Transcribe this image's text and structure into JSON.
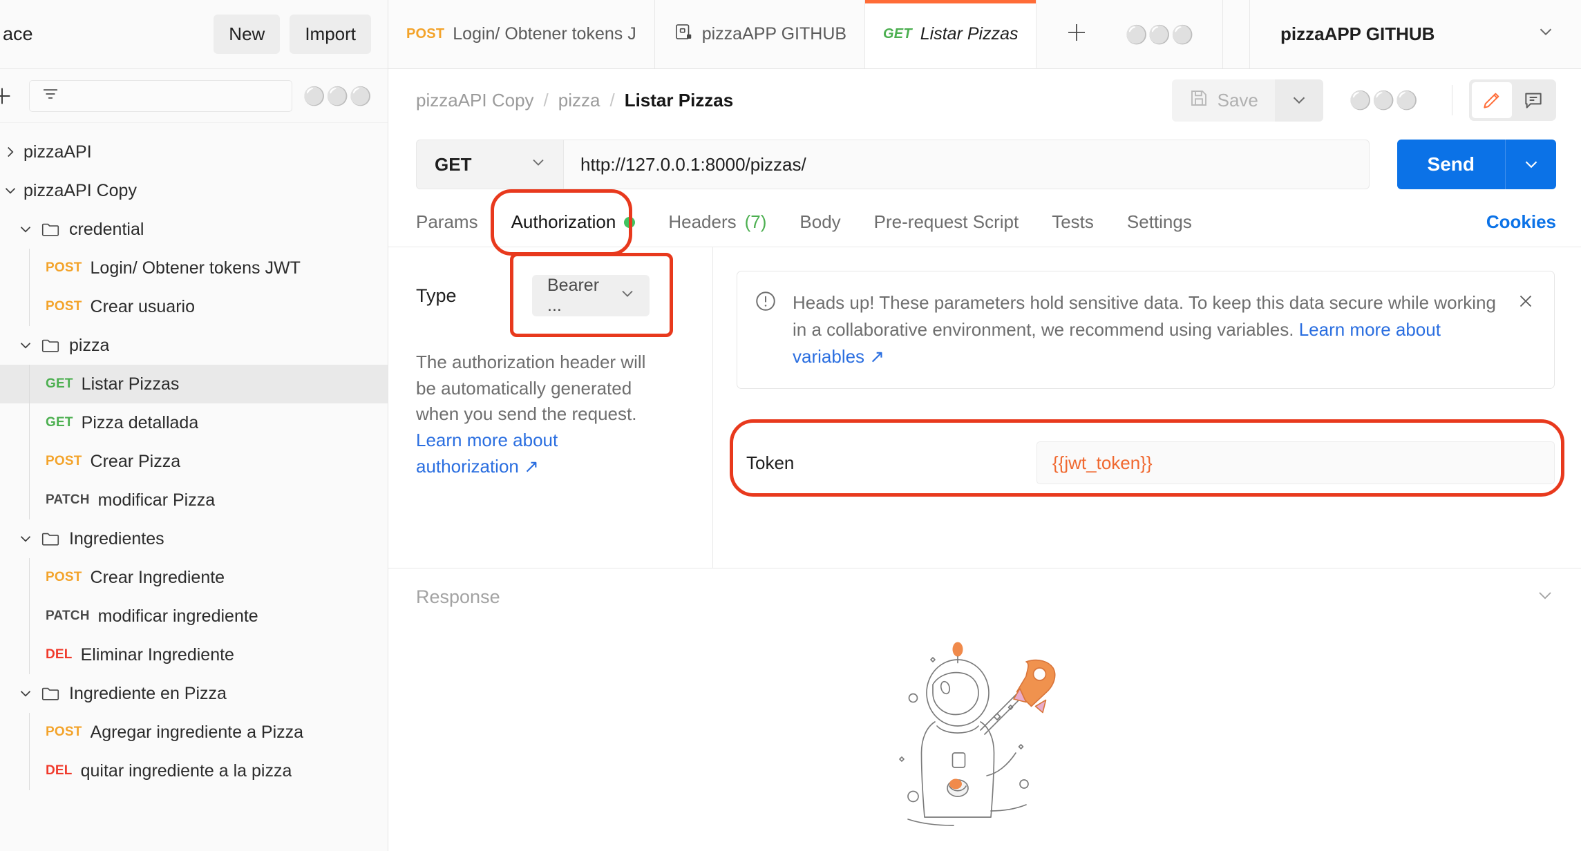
{
  "sidebar": {
    "workspace_title": "ace",
    "new_label": "New",
    "import_label": "Import",
    "filter_placeholder": "",
    "tree": [
      {
        "type": "collection",
        "label": "pizzaAPI",
        "expanded": false,
        "indent": 0
      },
      {
        "type": "collection",
        "label": "pizzaAPI Copy",
        "expanded": true,
        "indent": 0
      },
      {
        "type": "folder",
        "label": "credential",
        "expanded": true,
        "indent": 1
      },
      {
        "type": "request",
        "method": "POST",
        "label": "Login/ Obtener tokens JWT",
        "indent": 2
      },
      {
        "type": "request",
        "method": "POST",
        "label": "Crear usuario",
        "indent": 2
      },
      {
        "type": "folder",
        "label": "pizza",
        "expanded": true,
        "indent": 1
      },
      {
        "type": "request",
        "method": "GET",
        "label": "Listar Pizzas",
        "indent": 2,
        "selected": true
      },
      {
        "type": "request",
        "method": "GET",
        "label": "Pizza detallada",
        "indent": 2
      },
      {
        "type": "request",
        "method": "POST",
        "label": "Crear Pizza",
        "indent": 2
      },
      {
        "type": "request",
        "method": "PATCH",
        "label": "modificar Pizza",
        "indent": 2
      },
      {
        "type": "folder",
        "label": "Ingredientes",
        "expanded": true,
        "indent": 1
      },
      {
        "type": "request",
        "method": "POST",
        "label": "Crear Ingrediente",
        "indent": 2
      },
      {
        "type": "request",
        "method": "PATCH",
        "label": "modificar ingrediente",
        "indent": 2
      },
      {
        "type": "request",
        "method": "DEL",
        "label": "Eliminar Ingrediente",
        "indent": 2
      },
      {
        "type": "folder",
        "label": "Ingrediente en Pizza",
        "expanded": true,
        "indent": 1
      },
      {
        "type": "request",
        "method": "POST",
        "label": "Agregar ingrediente a Pizza",
        "indent": 2
      },
      {
        "type": "request",
        "method": "DEL",
        "label": "quitar ingrediente a la pizza",
        "indent": 2
      }
    ]
  },
  "tabstrip": {
    "tabs": [
      {
        "method": "POST",
        "name": "Login/ Obtener tokens J",
        "active": false,
        "icon": ""
      },
      {
        "method": "",
        "name": "pizzaAPP GITHUB",
        "active": false,
        "icon": "environment-icon"
      },
      {
        "method": "GET",
        "name": "Listar Pizzas",
        "active": true,
        "icon": ""
      }
    ],
    "new_tab_icon": "plus-icon",
    "more_tabs_icon": "ellipsis-icon",
    "environment_name": "pizzaAPP GITHUB",
    "environment_caret_icon": "chevron-down-icon"
  },
  "breadcrumb": {
    "items": [
      "pizzaAPI Copy",
      "pizza",
      "Listar Pizzas"
    ],
    "separator": "/",
    "save_label": "Save",
    "save_icon": "floppy-disk-icon",
    "save_caret_icon": "chevron-down-icon",
    "more_icon": "ellipsis-icon",
    "edit_icon": "pencil-icon",
    "comment_icon": "comment-icon"
  },
  "request": {
    "method": "GET",
    "method_caret_icon": "chevron-down-icon",
    "url": "http://127.0.0.1:8000/pizzas/",
    "send_label": "Send",
    "send_caret_icon": "chevron-down-icon"
  },
  "request_tabs": {
    "items": [
      {
        "label": "Params",
        "active": false
      },
      {
        "label": "Authorization",
        "active": true,
        "dot": true
      },
      {
        "label": "Headers",
        "count": "(7)",
        "active": false
      },
      {
        "label": "Body",
        "active": false
      },
      {
        "label": "Pre-request Script",
        "active": false
      },
      {
        "label": "Tests",
        "active": false
      },
      {
        "label": "Settings",
        "active": false
      }
    ],
    "cookies_label": "Cookies"
  },
  "authorization": {
    "type_label": "Type",
    "type_value": "Bearer ...",
    "type_caret_icon": "chevron-down-icon",
    "description": "The authorization header will be automatically generated when you send the request.",
    "learn_more_label": "Learn more about authorization ↗",
    "notice": {
      "icon": "alert-circle-icon",
      "text": "Heads up! These parameters hold sensitive data. To keep this data secure while working in a collaborative environment, we recommend using variables. ",
      "link_label": "Learn more about variables ↗",
      "close_icon": "close-icon"
    },
    "token_label": "Token",
    "token_value": "{{jwt_token}}"
  },
  "response": {
    "title": "Response",
    "collapse_icon": "chevron-down-icon",
    "illustration": "astronaut-rocket-illustration"
  },
  "colors": {
    "accent_orange": "#ff6c37",
    "send_blue": "#0b72e7",
    "highlight_red": "#e8391d",
    "method_get": "#4caf50",
    "method_post": "#f3a32a",
    "method_delete": "#f0392b",
    "variable_unresolved": "#f0682f"
  }
}
